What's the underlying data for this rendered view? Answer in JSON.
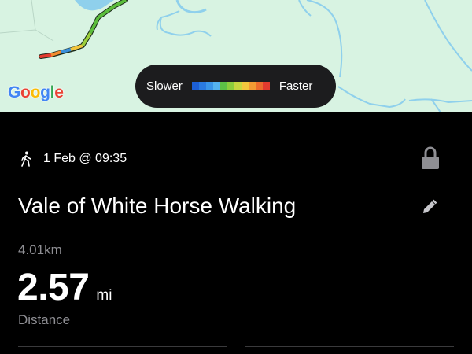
{
  "map": {
    "provider_logo": "Google",
    "background_color": "#d8f3e2",
    "water_color": "#8fd0ec",
    "route_colors": [
      "#3a8fdb",
      "#5bbd3c",
      "#9ccf3c",
      "#f2c53d",
      "#f28b2f",
      "#e33b2f"
    ]
  },
  "speed_legend": {
    "slower_label": "Slower",
    "faster_label": "Faster",
    "colors": [
      "#1c5fd6",
      "#2a7ae0",
      "#3a95e8",
      "#55b3ef",
      "#5cc046",
      "#8ccd3c",
      "#c6d640",
      "#f2c53d",
      "#f29a33",
      "#ec6b2d",
      "#e33b2f"
    ]
  },
  "activity": {
    "type_icon": "walking-person-icon",
    "date_text": "1 Feb @ 09:35",
    "title": "Vale of White Horse Walking",
    "lock_icon": "lock-icon",
    "edit_icon": "pencil-icon",
    "distance_km": "4.01km",
    "distance_value": "2.57",
    "distance_unit": "mi",
    "distance_label": "Distance"
  }
}
